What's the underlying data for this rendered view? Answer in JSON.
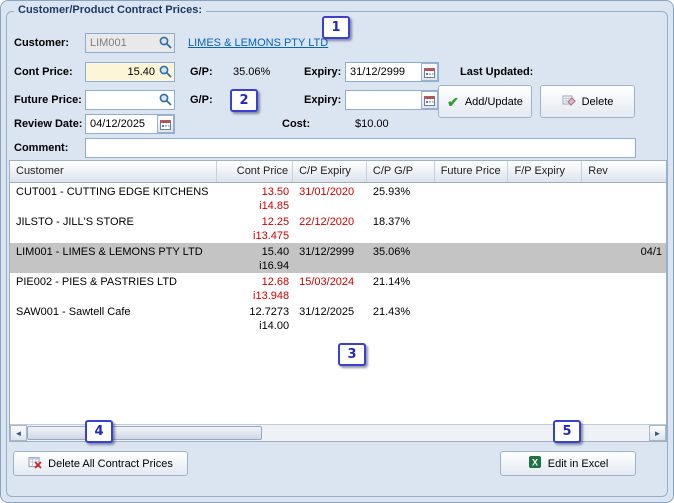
{
  "title": "Customer/Product Contract Prices:",
  "form": {
    "customer_label": "Customer:",
    "customer_code": "LIM001",
    "customer_name_link": "LIMES & LEMONS PTY LTD",
    "cont_price_label": "Cont Price:",
    "cont_price": "15.40",
    "gp_label": "G/P:",
    "gp_value": "35.06%",
    "expiry_label": "Expiry:",
    "expiry": "31/12/2999",
    "last_updated_label": "Last Updated:",
    "future_price_label": "Future Price:",
    "future_price": "",
    "future_gp_label": "G/P:",
    "future_gp_value": "",
    "future_expiry_label": "Expiry:",
    "future_expiry": "",
    "review_date_label": "Review Date:",
    "review_date": "04/12/2025",
    "cost_label": "Cost:",
    "cost_value": "$10.00",
    "comment_label": "Comment:",
    "comment": ""
  },
  "buttons": {
    "add_update": "Add/Update",
    "delete": "Delete",
    "delete_all": "Delete All Contract Prices",
    "edit_in_excel": "Edit in Excel"
  },
  "icons": {
    "check": "✔",
    "scroll_left": "◄",
    "scroll_right": "►"
  },
  "table": {
    "columns": [
      "Customer",
      "Cont Price",
      "C/P Expiry",
      "C/P G/P",
      "Future Price",
      "F/P Expiry",
      "Rev"
    ],
    "rows": [
      {
        "customer": "CUT001 - CUTTING EDGE KITCHENS",
        "cont_price": "13.50",
        "cont_price_inc": "i14.85",
        "cp_expiry": "31/01/2020",
        "cp_gp": "25.93%",
        "future_price": "",
        "fp_expiry": "",
        "review": "",
        "expired": true,
        "selected": false
      },
      {
        "customer": "JILSTO - JILL'S STORE",
        "cont_price": "12.25",
        "cont_price_inc": "i13.475",
        "cp_expiry": "22/12/2020",
        "cp_gp": "18.37%",
        "future_price": "",
        "fp_expiry": "",
        "review": "",
        "expired": true,
        "selected": false
      },
      {
        "customer": "LIM001 - LIMES & LEMONS PTY LTD",
        "cont_price": "15.40",
        "cont_price_inc": "i16.94",
        "cp_expiry": "31/12/2999",
        "cp_gp": "35.06%",
        "future_price": "",
        "fp_expiry": "",
        "review": "04/1",
        "expired": false,
        "selected": true
      },
      {
        "customer": "PIE002 - PIES & PASTRIES LTD",
        "cont_price": "12.68",
        "cont_price_inc": "i13.948",
        "cp_expiry": "15/03/2024",
        "cp_gp": "21.14%",
        "future_price": "",
        "fp_expiry": "",
        "review": "",
        "expired": true,
        "selected": false
      },
      {
        "customer": "SAW001 - Sawtell Cafe",
        "cont_price": "12.7273",
        "cont_price_inc": "i14.00",
        "cp_expiry": "31/12/2025",
        "cp_gp": "21.43%",
        "future_price": "",
        "fp_expiry": "",
        "review": "",
        "expired": false,
        "selected": false
      }
    ]
  },
  "callouts": [
    "1",
    "2",
    "3",
    "4",
    "5"
  ],
  "colors": {
    "expired_red": "#cf0000",
    "selected_row": "#c4c4c4",
    "link_blue": "#0563c1",
    "title_navy": "#1f3864",
    "cream_field": "#fdf5d7"
  }
}
